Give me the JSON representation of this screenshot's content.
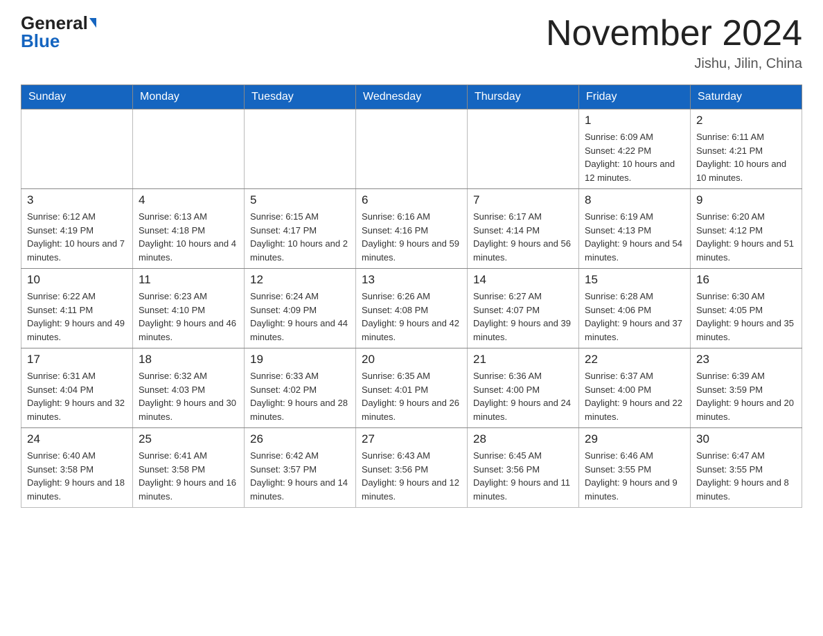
{
  "header": {
    "logo_general": "General",
    "logo_blue": "Blue",
    "month_title": "November 2024",
    "location": "Jishu, Jilin, China"
  },
  "days_of_week": [
    "Sunday",
    "Monday",
    "Tuesday",
    "Wednesday",
    "Thursday",
    "Friday",
    "Saturday"
  ],
  "weeks": [
    [
      {
        "day": "",
        "info": ""
      },
      {
        "day": "",
        "info": ""
      },
      {
        "day": "",
        "info": ""
      },
      {
        "day": "",
        "info": ""
      },
      {
        "day": "",
        "info": ""
      },
      {
        "day": "1",
        "info": "Sunrise: 6:09 AM\nSunset: 4:22 PM\nDaylight: 10 hours and 12 minutes."
      },
      {
        "day": "2",
        "info": "Sunrise: 6:11 AM\nSunset: 4:21 PM\nDaylight: 10 hours and 10 minutes."
      }
    ],
    [
      {
        "day": "3",
        "info": "Sunrise: 6:12 AM\nSunset: 4:19 PM\nDaylight: 10 hours and 7 minutes."
      },
      {
        "day": "4",
        "info": "Sunrise: 6:13 AM\nSunset: 4:18 PM\nDaylight: 10 hours and 4 minutes."
      },
      {
        "day": "5",
        "info": "Sunrise: 6:15 AM\nSunset: 4:17 PM\nDaylight: 10 hours and 2 minutes."
      },
      {
        "day": "6",
        "info": "Sunrise: 6:16 AM\nSunset: 4:16 PM\nDaylight: 9 hours and 59 minutes."
      },
      {
        "day": "7",
        "info": "Sunrise: 6:17 AM\nSunset: 4:14 PM\nDaylight: 9 hours and 56 minutes."
      },
      {
        "day": "8",
        "info": "Sunrise: 6:19 AM\nSunset: 4:13 PM\nDaylight: 9 hours and 54 minutes."
      },
      {
        "day": "9",
        "info": "Sunrise: 6:20 AM\nSunset: 4:12 PM\nDaylight: 9 hours and 51 minutes."
      }
    ],
    [
      {
        "day": "10",
        "info": "Sunrise: 6:22 AM\nSunset: 4:11 PM\nDaylight: 9 hours and 49 minutes."
      },
      {
        "day": "11",
        "info": "Sunrise: 6:23 AM\nSunset: 4:10 PM\nDaylight: 9 hours and 46 minutes."
      },
      {
        "day": "12",
        "info": "Sunrise: 6:24 AM\nSunset: 4:09 PM\nDaylight: 9 hours and 44 minutes."
      },
      {
        "day": "13",
        "info": "Sunrise: 6:26 AM\nSunset: 4:08 PM\nDaylight: 9 hours and 42 minutes."
      },
      {
        "day": "14",
        "info": "Sunrise: 6:27 AM\nSunset: 4:07 PM\nDaylight: 9 hours and 39 minutes."
      },
      {
        "day": "15",
        "info": "Sunrise: 6:28 AM\nSunset: 4:06 PM\nDaylight: 9 hours and 37 minutes."
      },
      {
        "day": "16",
        "info": "Sunrise: 6:30 AM\nSunset: 4:05 PM\nDaylight: 9 hours and 35 minutes."
      }
    ],
    [
      {
        "day": "17",
        "info": "Sunrise: 6:31 AM\nSunset: 4:04 PM\nDaylight: 9 hours and 32 minutes."
      },
      {
        "day": "18",
        "info": "Sunrise: 6:32 AM\nSunset: 4:03 PM\nDaylight: 9 hours and 30 minutes."
      },
      {
        "day": "19",
        "info": "Sunrise: 6:33 AM\nSunset: 4:02 PM\nDaylight: 9 hours and 28 minutes."
      },
      {
        "day": "20",
        "info": "Sunrise: 6:35 AM\nSunset: 4:01 PM\nDaylight: 9 hours and 26 minutes."
      },
      {
        "day": "21",
        "info": "Sunrise: 6:36 AM\nSunset: 4:00 PM\nDaylight: 9 hours and 24 minutes."
      },
      {
        "day": "22",
        "info": "Sunrise: 6:37 AM\nSunset: 4:00 PM\nDaylight: 9 hours and 22 minutes."
      },
      {
        "day": "23",
        "info": "Sunrise: 6:39 AM\nSunset: 3:59 PM\nDaylight: 9 hours and 20 minutes."
      }
    ],
    [
      {
        "day": "24",
        "info": "Sunrise: 6:40 AM\nSunset: 3:58 PM\nDaylight: 9 hours and 18 minutes."
      },
      {
        "day": "25",
        "info": "Sunrise: 6:41 AM\nSunset: 3:58 PM\nDaylight: 9 hours and 16 minutes."
      },
      {
        "day": "26",
        "info": "Sunrise: 6:42 AM\nSunset: 3:57 PM\nDaylight: 9 hours and 14 minutes."
      },
      {
        "day": "27",
        "info": "Sunrise: 6:43 AM\nSunset: 3:56 PM\nDaylight: 9 hours and 12 minutes."
      },
      {
        "day": "28",
        "info": "Sunrise: 6:45 AM\nSunset: 3:56 PM\nDaylight: 9 hours and 11 minutes."
      },
      {
        "day": "29",
        "info": "Sunrise: 6:46 AM\nSunset: 3:55 PM\nDaylight: 9 hours and 9 minutes."
      },
      {
        "day": "30",
        "info": "Sunrise: 6:47 AM\nSunset: 3:55 PM\nDaylight: 9 hours and 8 minutes."
      }
    ]
  ]
}
